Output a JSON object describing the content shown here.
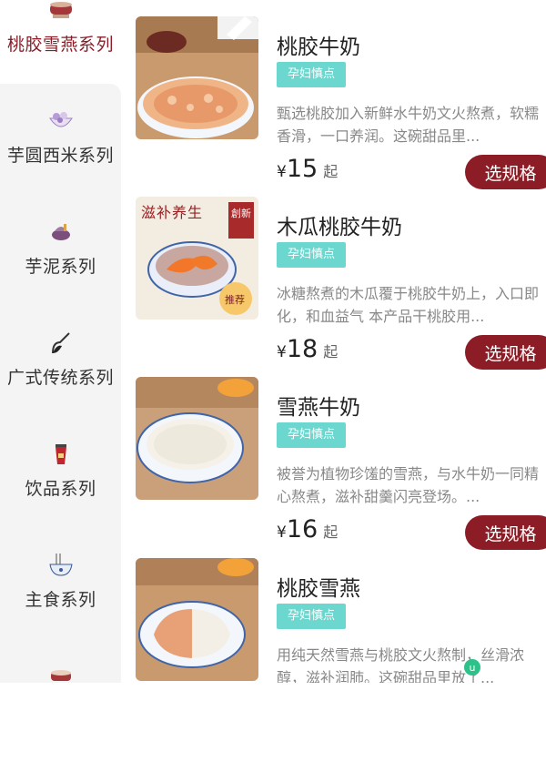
{
  "sidebar": {
    "items": [
      {
        "label": "桃胶雪燕系列",
        "icon": "bowl-dessert-icon",
        "active": true
      },
      {
        "label": "芋圆西米系列",
        "icon": "taro-ball-bowl-icon",
        "active": false
      },
      {
        "label": "芋泥系列",
        "icon": "taro-paste-icon",
        "active": false
      },
      {
        "label": "广式传统系列",
        "icon": "traditional-dessert-icon",
        "active": false
      },
      {
        "label": "饮品系列",
        "icon": "drink-cup-icon",
        "active": false
      },
      {
        "label": "主食系列",
        "icon": "noodle-bowl-icon",
        "active": false
      }
    ]
  },
  "products": [
    {
      "name": "桃胶牛奶",
      "badge": "孕妇慎点",
      "desc": "甄选桃胶加入新鲜水牛奶文火熬煮，软糯香滑，一口养润。这碗甜品里...",
      "currency": "¥",
      "price": "15",
      "price_suffix": "起",
      "button": "选规格"
    },
    {
      "name": "木瓜桃胶牛奶",
      "badge": "孕妇慎点",
      "desc": "冰糖熬煮的木瓜覆于桃胶牛奶上，入口即化，和血益气 本产品干桃胶用...",
      "currency": "¥",
      "price": "18",
      "price_suffix": "起",
      "button": "选规格",
      "thumb_text": {
        "top": "滋补养生",
        "seal": "創新",
        "tag": "推荐"
      }
    },
    {
      "name": "雪燕牛奶",
      "badge": "孕妇慎点",
      "desc": "被誉为植物珍馐的雪燕，与水牛奶一同精心熬煮，滋补甜羹闪亮登场。...",
      "currency": "¥",
      "price": "16",
      "price_suffix": "起",
      "button": "选规格"
    },
    {
      "name": "桃胶雪燕",
      "badge": "孕妇慎点",
      "desc": "用纯天然雪燕与桃胶文火熬制，丝滑浓醇，滋补润肺。这碗甜品里放了...",
      "currency": "¥",
      "price": "",
      "price_suffix": "",
      "button": ""
    }
  ],
  "colors": {
    "accent": "#8c1c25",
    "badge": "#3ccac0"
  }
}
